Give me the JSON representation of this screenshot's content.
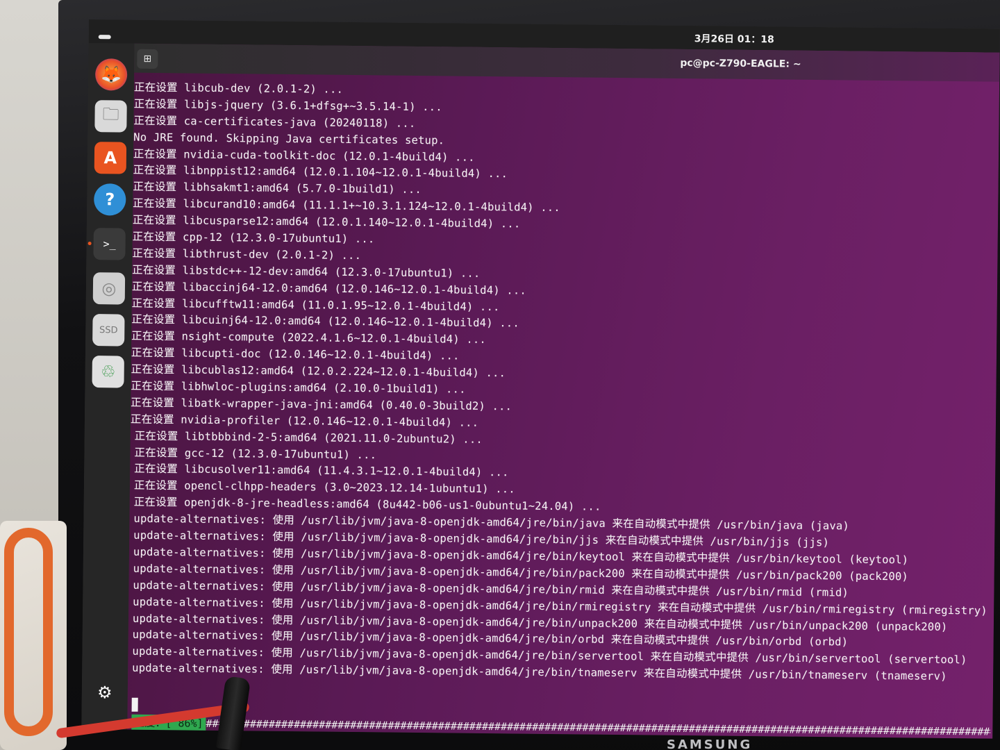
{
  "topbar": {
    "clock": "3月26日 01：18"
  },
  "dock": {
    "items": [
      {
        "name": "firefox-icon",
        "glyph": "🦊"
      },
      {
        "name": "files-icon",
        "glyph": "🗀"
      },
      {
        "name": "software-center-icon",
        "glyph": "A"
      },
      {
        "name": "help-icon",
        "glyph": "?"
      },
      {
        "name": "terminal-icon",
        "glyph": ">_"
      },
      {
        "name": "disc-icon",
        "glyph": "◎"
      },
      {
        "name": "ssd-drive-icon",
        "glyph": "SSD"
      },
      {
        "name": "trash-icon",
        "glyph": "♲"
      },
      {
        "name": "show-apps-icon",
        "glyph": "⚙"
      }
    ]
  },
  "terminal": {
    "title": "pc@pc-Z790-EAGLE: ~",
    "new_tab_glyph": "⊞",
    "lines": [
      "正在设置 libcub-dev (2.0.1-2) ...",
      "正在设置 libjs-jquery (3.6.1+dfsg+~3.5.14-1) ...",
      "正在设置 ca-certificates-java (20240118) ...",
      "No JRE found. Skipping Java certificates setup.",
      "正在设置 nvidia-cuda-toolkit-doc (12.0.1-4build4) ...",
      "正在设置 libnppist12:amd64 (12.0.1.104~12.0.1-4build4) ...",
      "正在设置 libhsakmt1:amd64 (5.7.0-1build1) ...",
      "正在设置 libcurand10:amd64 (11.1.1+~10.3.1.124~12.0.1-4build4) ...",
      "正在设置 libcusparse12:amd64 (12.0.1.140~12.0.1-4build4) ...",
      "正在设置 cpp-12 (12.3.0-17ubuntu1) ...",
      "正在设置 libthrust-dev (2.0.1-2) ...",
      "正在设置 libstdc++-12-dev:amd64 (12.3.0-17ubuntu1) ...",
      "正在设置 libaccinj64-12.0:amd64 (12.0.146~12.0.1-4build4) ...",
      "正在设置 libcufftw11:amd64 (11.0.1.95~12.0.1-4build4) ...",
      "正在设置 libcuinj64-12.0:amd64 (12.0.146~12.0.1-4build4) ...",
      "正在设置 nsight-compute (2022.4.1.6~12.0.1-4build4) ...",
      "正在设置 libcupti-doc (12.0.146~12.0.1-4build4) ...",
      "正在设置 libcublas12:amd64 (12.0.2.224~12.0.1-4build4) ...",
      "正在设置 libhwloc-plugins:amd64 (2.10.0-1build1) ...",
      "正在设置 libatk-wrapper-java-jni:amd64 (0.40.0-3build2) ...",
      "正在设置 nvidia-profiler (12.0.146~12.0.1-4build4) ...",
      "正在设置 libtbbbind-2-5:amd64 (2021.11.0-2ubuntu2) ...",
      "正在设置 gcc-12 (12.3.0-17ubuntu1) ...",
      "正在设置 libcusolver11:amd64 (11.4.3.1~12.0.1-4build4) ...",
      "正在设置 opencl-clhpp-headers (3.0~2023.12.14-1ubuntu1) ...",
      "正在设置 openjdk-8-jre-headless:amd64 (8u442-b06-us1-0ubuntu1~24.04) ...",
      "update-alternatives: 使用 /usr/lib/jvm/java-8-openjdk-amd64/jre/bin/java 来在自动模式中提供 /usr/bin/java (java)",
      "update-alternatives: 使用 /usr/lib/jvm/java-8-openjdk-amd64/jre/bin/jjs 来在自动模式中提供 /usr/bin/jjs (jjs)",
      "update-alternatives: 使用 /usr/lib/jvm/java-8-openjdk-amd64/jre/bin/keytool 来在自动模式中提供 /usr/bin/keytool (keytool)",
      "update-alternatives: 使用 /usr/lib/jvm/java-8-openjdk-amd64/jre/bin/pack200 来在自动模式中提供 /usr/bin/pack200 (pack200)",
      "update-alternatives: 使用 /usr/lib/jvm/java-8-openjdk-amd64/jre/bin/rmid 来在自动模式中提供 /usr/bin/rmid (rmid)",
      "update-alternatives: 使用 /usr/lib/jvm/java-8-openjdk-amd64/jre/bin/rmiregistry 来在自动模式中提供 /usr/bin/rmiregistry (rmiregistry)",
      "update-alternatives: 使用 /usr/lib/jvm/java-8-openjdk-amd64/jre/bin/unpack200 来在自动模式中提供 /usr/bin/unpack200 (unpack200)",
      "update-alternatives: 使用 /usr/lib/jvm/java-8-openjdk-amd64/jre/bin/orbd 来在自动模式中提供 /usr/bin/orbd (orbd)",
      "update-alternatives: 使用 /usr/lib/jvm/java-8-openjdk-amd64/jre/bin/servertool 来在自动模式中提供 /usr/bin/servertool (servertool)",
      "update-alternatives: 使用 /usr/lib/jvm/java-8-openjdk-amd64/jre/bin/tnameserv 来在自动模式中提供 /usr/bin/tnameserv (tnameserv)"
    ],
    "progress": {
      "label": "进度：[ 86%]",
      "fraction": 0.86,
      "bar_text": "#############################################################################################################################################"
    }
  },
  "monitor": {
    "brand": "SAMSUNG"
  },
  "colors": {
    "terminal_bg": "#5a1a55",
    "progress_label_bg": "#2fa84f",
    "ubuntu_accent": "#e95420"
  }
}
